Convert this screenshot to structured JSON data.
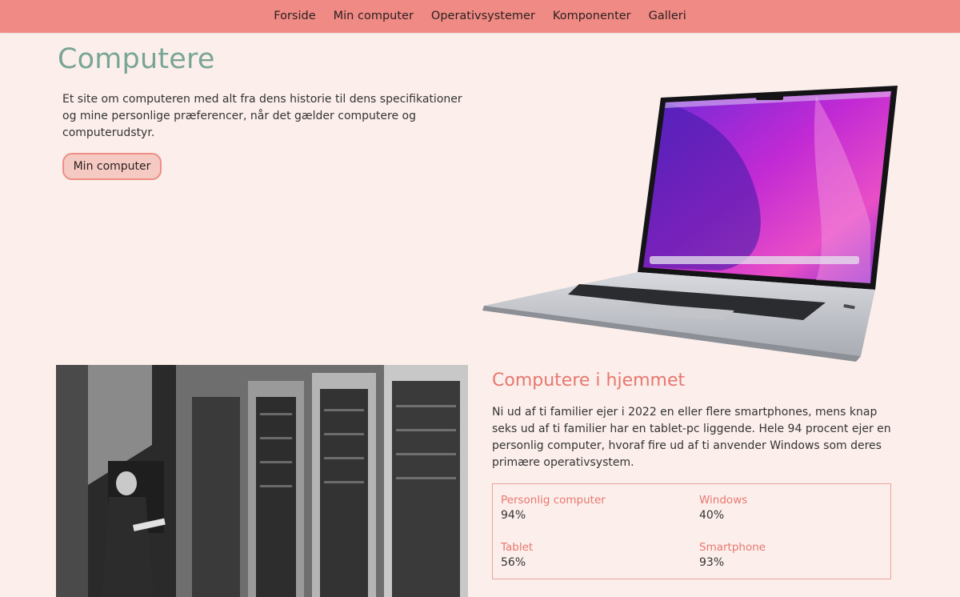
{
  "nav": {
    "items": [
      {
        "label": "Forside"
      },
      {
        "label": "Min computer"
      },
      {
        "label": "Operativsystemer"
      },
      {
        "label": "Komponenter"
      },
      {
        "label": "Galleri"
      }
    ]
  },
  "hero": {
    "title": "Computere",
    "intro": "Et site om computeren med alt fra dens historie til dens specifikationer og mine personlige præferencer, når det gælder computere og computerudstyr.",
    "button_label": "Min computer"
  },
  "home_section": {
    "title": "Computere i hjemmet",
    "text": "Ni ud af ti familier ejer i 2022 en eller flere smartphones, mens knap seks ud af ti familier har en tablet-pc liggende. Hele 94 procent ejer en personlig computer, hvoraf fire ud af ti anvender Windows som deres primære operativsystem.",
    "stats": [
      {
        "label": "Personlig computer",
        "value": "94%"
      },
      {
        "label": "Windows",
        "value": "40%"
      },
      {
        "label": "Tablet",
        "value": "56%"
      },
      {
        "label": "Smartphone",
        "value": "93%"
      }
    ]
  },
  "colors": {
    "nav_bg": "#f08a84",
    "page_bg": "#fcefeb",
    "title": "#79a596",
    "accent": "#e8766f",
    "button_bg": "#f5cac3"
  }
}
